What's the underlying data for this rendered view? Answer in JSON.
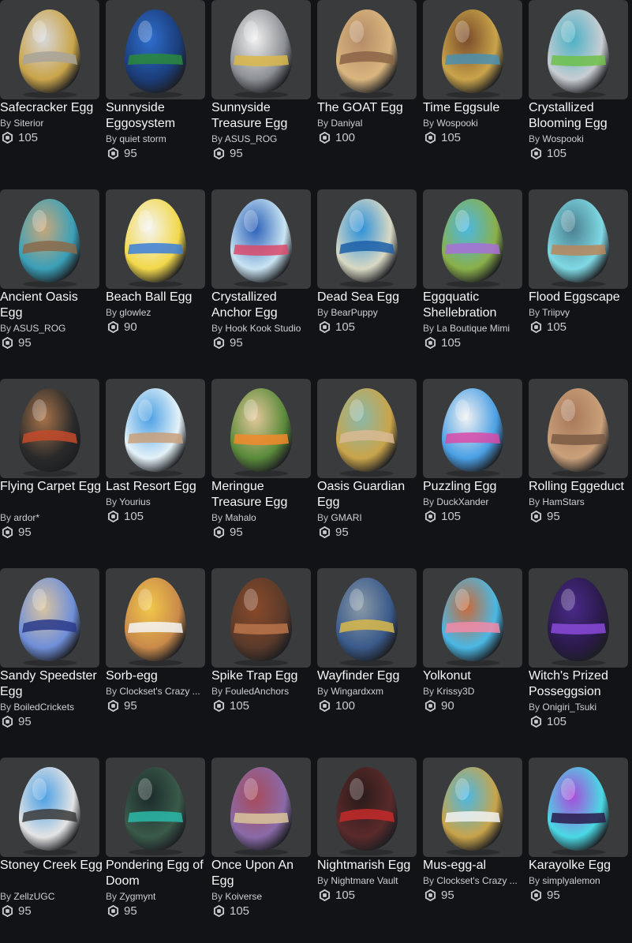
{
  "currency_icon": "robux-icon",
  "items": [
    {
      "name": "Safecracker Egg",
      "by": "By",
      "creator": "Siterior",
      "price": "105",
      "colors": [
        "#d8d8dc",
        "#a8a39a",
        "#c9a44a"
      ]
    },
    {
      "name": "Sunnyside Eggosystem",
      "by": "By",
      "creator": "quiet storm",
      "price": "95",
      "colors": [
        "#2f6fcf",
        "#2a8a3a",
        "#1b3d7a"
      ]
    },
    {
      "name": "Sunnyside Treasure Egg",
      "by": "By",
      "creator": "ASUS_ROG",
      "price": "95",
      "colors": [
        "#f2f2f2",
        "#d9b84a",
        "#8c8f94"
      ]
    },
    {
      "name": "The GOAT Egg",
      "by": "By",
      "creator": "Daniyal",
      "price": "100",
      "colors": [
        "#b48a66",
        "#8a6446",
        "#d9b57e"
      ]
    },
    {
      "name": "Time Eggsule",
      "by": "By",
      "creator": "Wospooki",
      "price": "105",
      "colors": [
        "#7a4a2a",
        "#4a8fb0",
        "#c9a44a"
      ]
    },
    {
      "name": "Crystallized Blooming Egg",
      "by": "By",
      "creator": "Wospooki",
      "price": "105",
      "colors": [
        "#4ab0c4",
        "#6fbf4a",
        "#c8cdd2"
      ]
    },
    {
      "name": "Ancient Oasis Egg",
      "by": "By",
      "creator": "ASUS_ROG",
      "price": "95",
      "colors": [
        "#c9a77a",
        "#8a6a4a",
        "#3aa0b8"
      ]
    },
    {
      "name": "Beach Ball Egg",
      "by": "By",
      "creator": "glowlez",
      "price": "90",
      "colors": [
        "#f4f4f4",
        "#3a7fd9",
        "#f2d84a"
      ]
    },
    {
      "name": "Crystallized Anchor Egg",
      "by": "By",
      "creator": "Hook Kook Studio",
      "price": "95",
      "colors": [
        "#2a5fb8",
        "#d94a6a",
        "#c9e4f2"
      ]
    },
    {
      "name": "Dead Sea Egg",
      "by": "By",
      "creator": "BearPuppy",
      "price": "105",
      "colors": [
        "#2a8fd9",
        "#1b5fa8",
        "#d9d9c4"
      ]
    },
    {
      "name": "Eggquatic Shellebration",
      "by": "By",
      "creator": "La Boutique Mimi",
      "price": "105",
      "colors": [
        "#4ab8e4",
        "#a86fd9",
        "#8ab04a"
      ]
    },
    {
      "name": "Flood Eggscape",
      "by": "By",
      "creator": "Triipvy",
      "price": "105",
      "colors": [
        "#4a7f8f",
        "#b8865a",
        "#7fd9e4"
      ]
    },
    {
      "name": "Flying Carpet Egg",
      "by": "By",
      "creator": "ardor*",
      "price": "95",
      "colors": [
        "#a8744a",
        "#c44a2a",
        "#2a2a2a"
      ]
    },
    {
      "name": "Last Resort Egg",
      "by": "By",
      "creator": "Yourius",
      "price": "105",
      "colors": [
        "#4a9fe4",
        "#c9a07a",
        "#e4f2f8"
      ]
    },
    {
      "name": "Meringue Treasure Egg",
      "by": "By",
      "creator": "Mahalo",
      "price": "95",
      "colors": [
        "#e4c89a",
        "#f28a2a",
        "#5a8a3a"
      ]
    },
    {
      "name": "Oasis Guardian Egg",
      "by": "By",
      "creator": "GMARI",
      "price": "95",
      "colors": [
        "#8ab8a8",
        "#d9b894",
        "#c9a44a"
      ]
    },
    {
      "name": "Puzzling Egg",
      "by": "By",
      "creator": "DuckXander",
      "price": "105",
      "colors": [
        "#f2f2f2",
        "#d94aa8",
        "#4a9fe4"
      ]
    },
    {
      "name": "Rolling Eggeduct",
      "by": "By",
      "creator": "HamStars",
      "price": "95",
      "colors": [
        "#a8785a",
        "#7a5a44",
        "#c9a07a"
      ]
    },
    {
      "name": "Sandy Speedster Egg",
      "by": "By",
      "creator": "BoiledCrickets",
      "price": "95",
      "colors": [
        "#d9c4a0",
        "#2a3a8a",
        "#6f8fd9"
      ]
    },
    {
      "name": "Sorb-egg",
      "by": "By",
      "creator": "Clockset's Crazy ...",
      "price": "95",
      "colors": [
        "#f2c84a",
        "#f4f4f4",
        "#c98a4a"
      ]
    },
    {
      "name": "Spike Trap Egg",
      "by": "By",
      "creator": "FouledAnchors",
      "price": "105",
      "colors": [
        "#8a4a2a",
        "#b8744a",
        "#5a3a2a"
      ]
    },
    {
      "name": "Wayfinder Egg",
      "by": "By",
      "creator": "Wingardxxm",
      "price": "100",
      "colors": [
        "#8a9aa8",
        "#d9b84a",
        "#3a5a8a"
      ]
    },
    {
      "name": "Yolkonut",
      "by": "By",
      "creator": "Krissy3D",
      "price": "90",
      "colors": [
        "#c96a3a",
        "#f28aa8",
        "#4ab8e4"
      ]
    },
    {
      "name": "Witch's Prized Posseggsion",
      "by": "By",
      "creator": "Onigiri_Tsuki",
      "price": "105",
      "colors": [
        "#4a2a8a",
        "#8a4ad9",
        "#2a1a4a"
      ]
    },
    {
      "name": "Stoney Creek Egg",
      "by": "By",
      "creator": "ZellzUGC",
      "price": "95",
      "colors": [
        "#4a9fe4",
        "#3a3a3a",
        "#e4e4e4"
      ]
    },
    {
      "name": "Pondering Egg of Doom",
      "by": "By",
      "creator": "Zygmynt",
      "price": "95",
      "colors": [
        "#1b2a2a",
        "#2ab8a8",
        "#3a5a4a"
      ]
    },
    {
      "name": "Once Upon An Egg",
      "by": "By",
      "creator": "Koiverse",
      "price": "105",
      "colors": [
        "#a84a5a",
        "#d9c49a",
        "#8a6aa8"
      ]
    },
    {
      "name": "Nightmarish Egg",
      "by": "By",
      "creator": "Nightmare Vault",
      "price": "105",
      "colors": [
        "#2a1a1a",
        "#c42a2a",
        "#5a2a2a"
      ]
    },
    {
      "name": "Mus-egg-al",
      "by": "By",
      "creator": "Clockset's Crazy ...",
      "price": "95",
      "colors": [
        "#4ab8e4",
        "#f2f2f2",
        "#c9a44a"
      ]
    },
    {
      "name": "Karayolke Egg",
      "by": "By",
      "creator": "simplyalemon",
      "price": "95",
      "colors": [
        "#a84ad9",
        "#2a1a4a",
        "#4ad9e4"
      ]
    }
  ]
}
